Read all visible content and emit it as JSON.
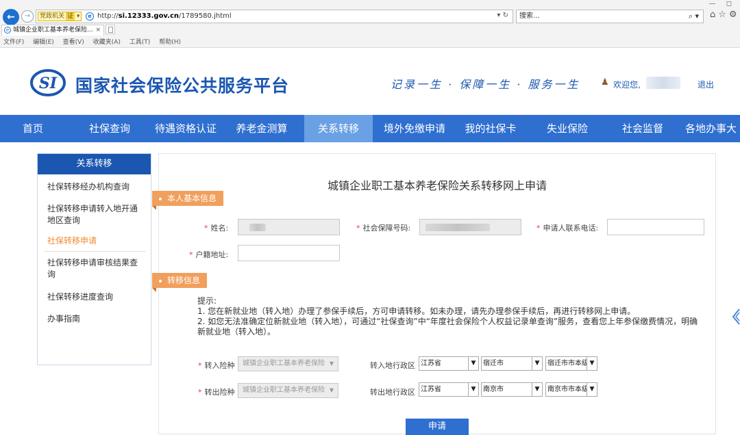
{
  "browser": {
    "window_controls": "— ◻",
    "site_badge": "党政机关",
    "cert_badge": "证",
    "url_host": "si.12333.gov.cn",
    "url_prefix": "http://",
    "url_path": "/1789580.jhtml",
    "addr_right": "▾ ↻",
    "search_placeholder": "搜索...",
    "search_icon_glyph": "⌕ ▾",
    "toolbar_icons": "⌂☆⚙",
    "tab_title": "城镇企业职工基本养老保险...",
    "tab_close": "×",
    "menu": [
      "文件(F)",
      "编辑(E)",
      "查看(V)",
      "收藏夹(A)",
      "工具(T)",
      "帮助(H)"
    ]
  },
  "header": {
    "logo_text": "SI",
    "title": "国家社会保险公共服务平台",
    "slogan": "记录一生 · 保障一生 · 服务一生",
    "welcome": "欢迎您,",
    "logout": "退出"
  },
  "nav": {
    "items": [
      "首页",
      "社保查询",
      "待遇资格认证",
      "养老金测算",
      "关系转移",
      "境外免缴申请",
      "我的社保卡",
      "失业保险",
      "社会监督",
      "各地办事大"
    ],
    "active_index": 4
  },
  "sidebar": {
    "title": "关系转移",
    "items": [
      "社保转移经办机构查询",
      "社保转移申请转入地开通地区查询",
      "社保转移申请",
      "社保转移申请审核结果查询",
      "社保转移进度查询",
      "办事指南"
    ],
    "active_index": 2
  },
  "form": {
    "title": "城镇企业职工基本养老保险关系转移网上申请",
    "section_basic": "本人基本信息",
    "section_transfer": "转移信息",
    "required_mark": "*",
    "name_label": "姓名:",
    "ssn_label": "社会保障号码:",
    "phone_label": "申请人联系电话:",
    "hukou_label": "户籍地址:",
    "tips_title": "提示:",
    "tips": [
      "1. 您在新就业地（转入地）办理了参保手续后，方可申请转移。如未办理，请先办理参保手续后，再进行转移网上申请。",
      "2. 如您无法准确定位新就业地（转入地），可通过“社保查询”中“年度社会保险个人权益记录单查询”服务，查看您上年参保缴费情况，明确新就业地（转入地）。"
    ],
    "in_insurance_label": "转入险种",
    "out_insurance_label": "转出险种",
    "insurance_value": "城镇企业职工基本养老保险",
    "in_region_label": "转入地行政区",
    "out_region_label": "转出地行政区",
    "in_province": "江苏省",
    "in_city": "宿迁市",
    "in_district": "宿迁市市本级",
    "out_province": "江苏省",
    "out_city": "南京市",
    "out_district": "南京市市本级",
    "submit": "申请"
  },
  "colors": {
    "brand_blue": "#1b57b0",
    "nav_blue": "#2f6fd0",
    "nav_active": "#6aa0e4",
    "tag_orange": "#f19f5c",
    "active_link": "#f08a2c"
  }
}
